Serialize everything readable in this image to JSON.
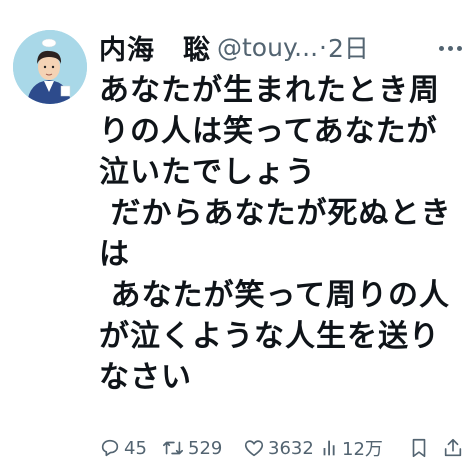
{
  "tweet": {
    "author": {
      "name_part1": "内海",
      "name_part2": "聡",
      "handle": "@touy...",
      "separator": "·",
      "time": "2日"
    },
    "lines": [
      "あなたが生まれたとき周",
      "りの人は笑ってあなたが",
      "泣いたでしょう",
      " だからあなたが死ぬとき",
      "は",
      " あなたが笑って周りの人",
      "が泣くような人生を送り",
      "なさい"
    ],
    "actions": {
      "replies": "45",
      "retweets": "529",
      "likes": "3632",
      "views": "12万"
    },
    "colors": {
      "text": "#0f1419",
      "muted": "#536471",
      "avatar_bg": "#a9d8e8"
    }
  }
}
